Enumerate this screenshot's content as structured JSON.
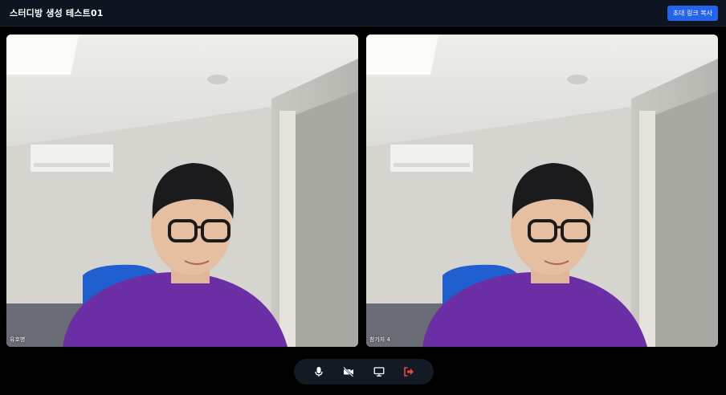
{
  "header": {
    "room_title": "스터디방 생성 테스트01",
    "invite_button_label": "초대 링크 복사"
  },
  "participants": [
    {
      "name": "유호병"
    },
    {
      "name": "참가자 4"
    }
  ],
  "controls": {
    "mic_icon": "microphone-icon",
    "camera_icon": "camera-off-icon",
    "screen_icon": "monitor-icon",
    "leave_icon": "leave-icon",
    "leave_color": "#ef4444"
  },
  "colors": {
    "accent": "#2563eb",
    "header_bg": "#0f1520"
  }
}
